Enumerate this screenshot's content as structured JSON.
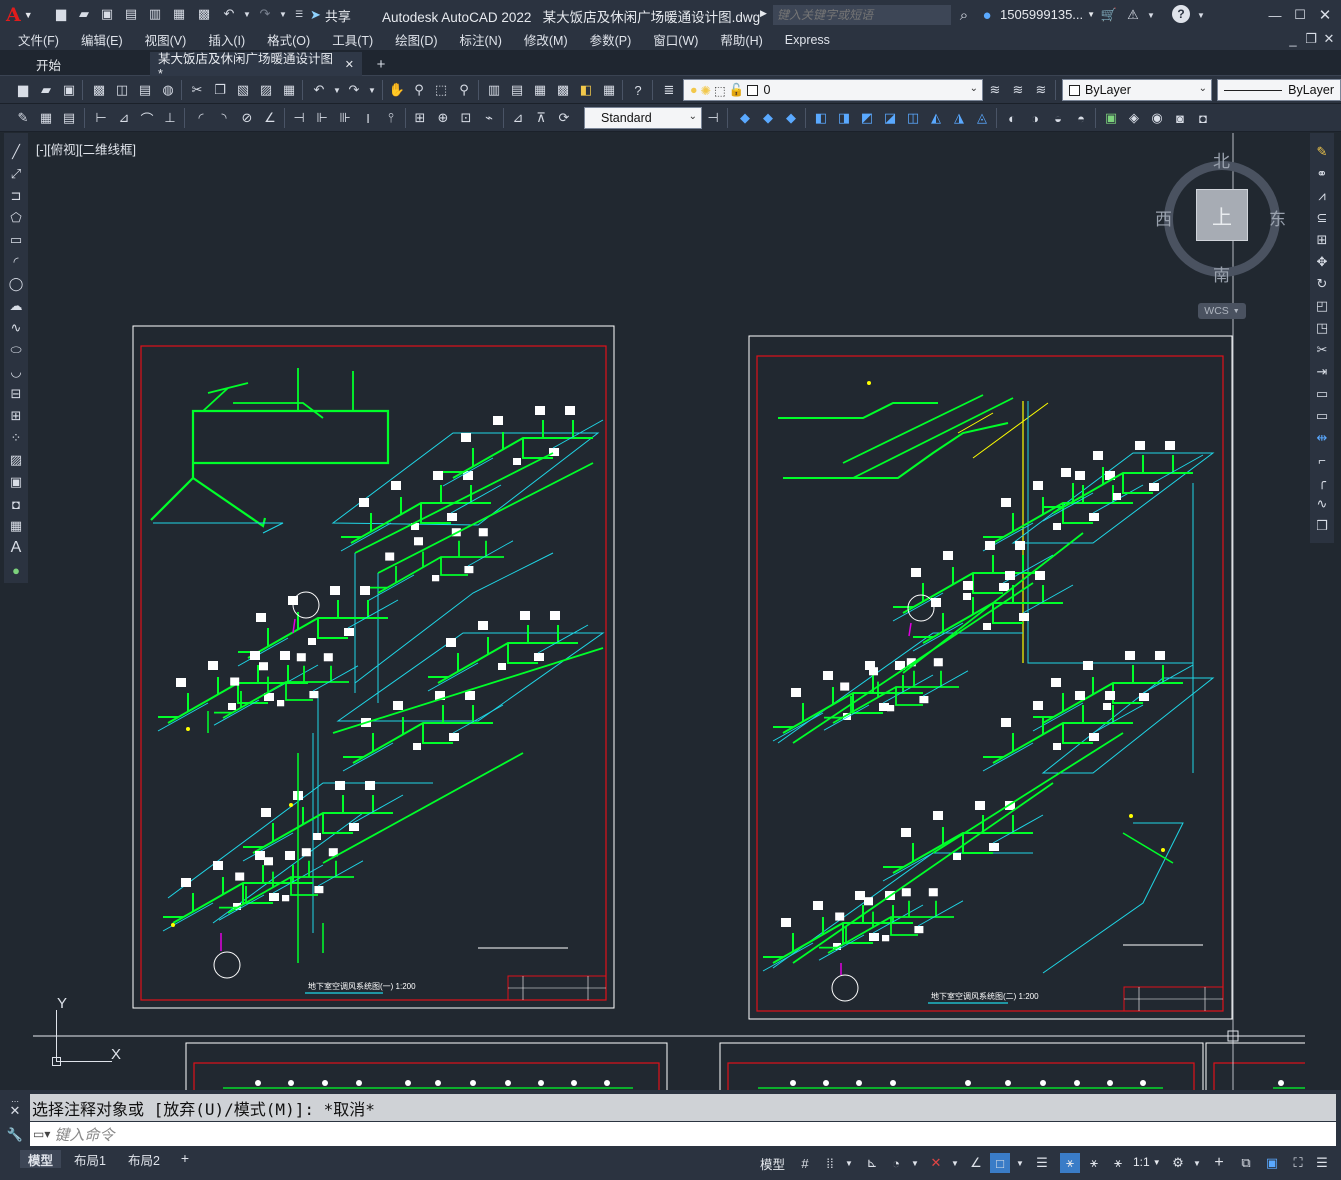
{
  "app": {
    "title": "Autodesk AutoCAD 2022   某大饭店及休闲广场暖通设计图.dwg",
    "logo": "A",
    "share": "共享",
    "search_placeholder": "键入关键字或短语",
    "user": "1505999135...",
    "help": "?"
  },
  "menu": [
    "文件(F)",
    "编辑(E)",
    "视图(V)",
    "插入(I)",
    "格式(O)",
    "工具(T)",
    "绘图(D)",
    "标注(N)",
    "修改(M)",
    "参数(P)",
    "窗口(W)",
    "帮助(H)",
    "Express"
  ],
  "tabs": [
    {
      "label": "开始"
    },
    {
      "label": "某大饭店及休闲广场暖通设计图*"
    }
  ],
  "layers": {
    "current_layer": "0",
    "text_style": "Standard",
    "color": "ByLayer",
    "linetype": "ByLayer"
  },
  "viewport": {
    "label": "[-][俯视][二维线框]",
    "viewcube": {
      "north": "北",
      "south": "南",
      "east": "东",
      "west": "西",
      "top": "上",
      "wcs": "WCS"
    },
    "ucs": {
      "y": "Y",
      "x": "X"
    }
  },
  "drawing": {
    "sheet1_title": "地下室空调风系统图(一)    1:200",
    "sheet2_title": "地下室空调风系统图(二)    1:200",
    "colors": {
      "green": "#00ff2a",
      "cyan": "#1fd6e6",
      "yellow": "#ffff00",
      "red": "#e0101a",
      "white": "#ffffff",
      "magenta": "#e000e0"
    }
  },
  "command": {
    "history": "选择注释对象或 [放弃(U)/模式(M)]: *取消*",
    "input_placeholder": "键入命令"
  },
  "status": {
    "layout_tabs": [
      "模型",
      "布局1",
      "布局2"
    ],
    "model_label": "模型",
    "scale": "1:1"
  }
}
